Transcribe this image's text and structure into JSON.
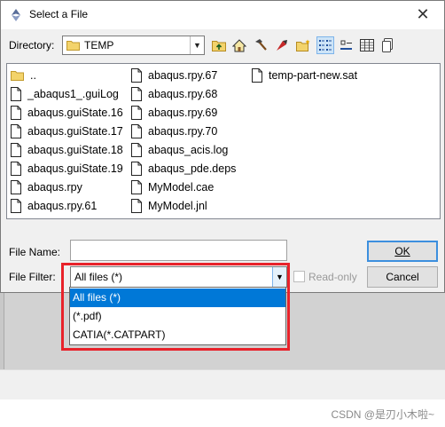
{
  "dialog": {
    "title": "Select a File",
    "close_glyph": "✕"
  },
  "directory": {
    "label": "Directory:",
    "value": "TEMP"
  },
  "toolbar": {
    "icons": [
      "folder-up-icon",
      "home-icon",
      "hammer-icon",
      "bookmark-icon",
      "new-folder-icon",
      "list-view-icon",
      "icon-view-icon",
      "details-view-icon",
      "copy-icon"
    ]
  },
  "files": {
    "columns": [
      [
        {
          "name": "..",
          "kind": "folder"
        },
        {
          "name": "_abaqus1_.guiLog",
          "kind": "file"
        },
        {
          "name": "abaqus.guiState.16",
          "kind": "file"
        },
        {
          "name": "abaqus.guiState.17",
          "kind": "file"
        },
        {
          "name": "abaqus.guiState.18",
          "kind": "file"
        },
        {
          "name": "abaqus.guiState.19",
          "kind": "file"
        },
        {
          "name": "abaqus.rpy",
          "kind": "file"
        },
        {
          "name": "abaqus.rpy.61",
          "kind": "file"
        }
      ],
      [
        {
          "name": "abaqus.rpy.67",
          "kind": "file"
        },
        {
          "name": "abaqus.rpy.68",
          "kind": "file"
        },
        {
          "name": "abaqus.rpy.69",
          "kind": "file"
        },
        {
          "name": "abaqus.rpy.70",
          "kind": "file"
        },
        {
          "name": "abaqus_acis.log",
          "kind": "file"
        },
        {
          "name": "abaqus_pde.deps",
          "kind": "file"
        },
        {
          "name": "MyModel.cae",
          "kind": "file"
        },
        {
          "name": "MyModel.jnl",
          "kind": "file"
        }
      ],
      [
        {
          "name": "temp-part-new.sat",
          "kind": "file"
        }
      ]
    ]
  },
  "file_name": {
    "label": "File Name:",
    "value": ""
  },
  "file_filter": {
    "label": "File Filter:",
    "value": "All files (*)",
    "options": [
      "All files (*)",
      "(*.pdf)",
      "CATIA(*.CATPART)"
    ],
    "selected_index": 0
  },
  "read_only": {
    "label": "Read-only",
    "checked": false,
    "enabled": false
  },
  "buttons": {
    "ok": "OK",
    "cancel": "Cancel"
  },
  "watermark": "CSDN @是刃小木啦~",
  "colors": {
    "selection": "#0078d7",
    "annotation": "#e8222a",
    "default_button_border": "#3c8fde"
  }
}
